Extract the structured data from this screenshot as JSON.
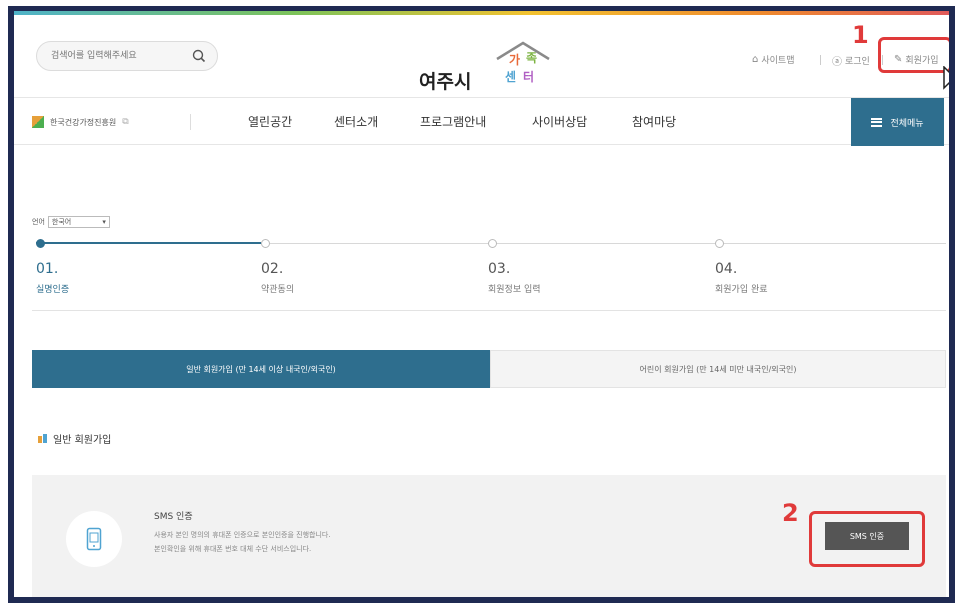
{
  "header": {
    "search": {
      "placeholder": "검색어를 입력해주세요"
    },
    "logo": {
      "text": "여주시",
      "ga": "가",
      "jok": "족",
      "sen": "센",
      "teo": "터"
    },
    "util": {
      "sitemap": "사이트맵",
      "login": "로그인",
      "join": "회원가입"
    }
  },
  "annotations": {
    "one": "1",
    "two": "2"
  },
  "nav": {
    "family_site": "한국건강가정진흥원",
    "items": [
      "열린공간",
      "센터소개",
      "프로그램안내",
      "사이버상담",
      "참여마당"
    ],
    "full_menu": "전체메뉴"
  },
  "steps": {
    "lang_label": "언어",
    "lang_value": "한국어",
    "items": [
      {
        "num": "01.",
        "label": "실명인증"
      },
      {
        "num": "02.",
        "label": "약관동의"
      },
      {
        "num": "03.",
        "label": "회원정보 입력"
      },
      {
        "num": "04.",
        "label": "회원가입 완료"
      }
    ]
  },
  "tabs": {
    "active": "일반 회원가입 (만 14세 이상 내국인/외국인)",
    "inactive": "어린이 회원가입 (만 14세 미만 내국인/외국인)"
  },
  "section": {
    "title": "일반 회원가입"
  },
  "sms": {
    "title": "SMS 인증",
    "desc1": "사용자 본인 명의의 휴대폰 인증으로 본인인증을 진행합니다.",
    "desc2": "본인확인을 위해 휴대폰 번호 대체 수단 서비스입니다.",
    "button": "SMS 인증"
  },
  "colors": {
    "primary": "#2e6e8e",
    "annotation": "#e03a3a",
    "frame": "#1f2a52"
  }
}
